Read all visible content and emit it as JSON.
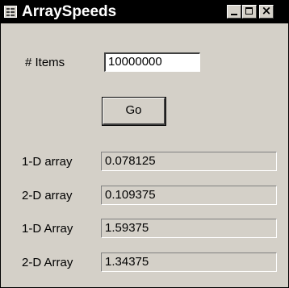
{
  "window": {
    "title": "ArraySpeeds",
    "icon": "app-icon",
    "controls": {
      "minimize": "minimize-icon",
      "maximize": "maximize-icon",
      "close": "×"
    }
  },
  "form": {
    "items_label": "# Items",
    "items_value": "10000000",
    "go_label": "Go"
  },
  "results": [
    {
      "label": "1-D array",
      "value": "0.078125"
    },
    {
      "label": "2-D array",
      "value": "0.109375"
    },
    {
      "label": "1-D Array",
      "value": "1.59375"
    },
    {
      "label": "2-D Array",
      "value": "1.34375"
    }
  ]
}
